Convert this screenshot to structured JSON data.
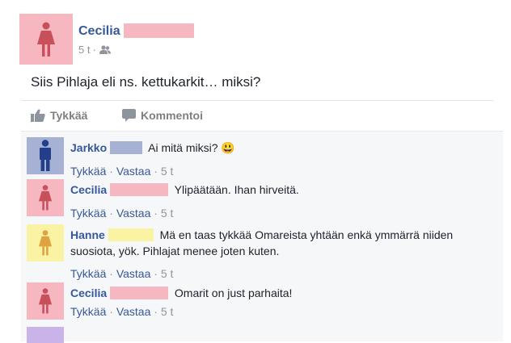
{
  "post": {
    "author": "Cecilia",
    "time": "5 t",
    "meta_sep": "·",
    "audience_icon": "friends-icon",
    "text": "Siis Pihlaja eli ns. kettukarkit… miksi?",
    "avatar_color": "#f7b7c1",
    "avatar_figure": "#c8505a",
    "redact_color": "#f7b7c1"
  },
  "actions": {
    "like_label": "Tykkää",
    "comment_label": "Kommentoi"
  },
  "comments": [
    {
      "name": "Jarkko",
      "text": "Ai mitä miksi?",
      "emoji": "😃",
      "like": "Tykkää",
      "reply": "Vastaa",
      "time": "5 t",
      "avatar_color": "#a7b1d4",
      "avatar_figure": "#233e8a",
      "redact_color": "#a7b1d4"
    },
    {
      "name": "Cecilia",
      "text": "Ylipäätään. Ihan hirveitä.",
      "like": "Tykkää",
      "reply": "Vastaa",
      "time": "5 t",
      "avatar_color": "#f7b7c1",
      "avatar_figure": "#c8505a",
      "redact_color": "#f7b7c1"
    },
    {
      "name": "Hanne",
      "text": "Mä en taas tykkää Omareista yhtään enkä ymmärrä niiden suosiota, yök. Pihlajat menee joten kuten.",
      "like": "Tykkää",
      "reply": "Vastaa",
      "time": "5 t",
      "avatar_color": "#fbf3a4",
      "avatar_figure": "#e0a240",
      "redact_color": "#fbf3a4"
    },
    {
      "name": "Cecilia",
      "text": "Omarit on just parhaita!",
      "like": "Tykkää",
      "reply": "Vastaa",
      "time": "5 t",
      "avatar_color": "#f7b7c1",
      "avatar_figure": "#c8505a",
      "redact_color": "#f7b7c1"
    }
  ]
}
